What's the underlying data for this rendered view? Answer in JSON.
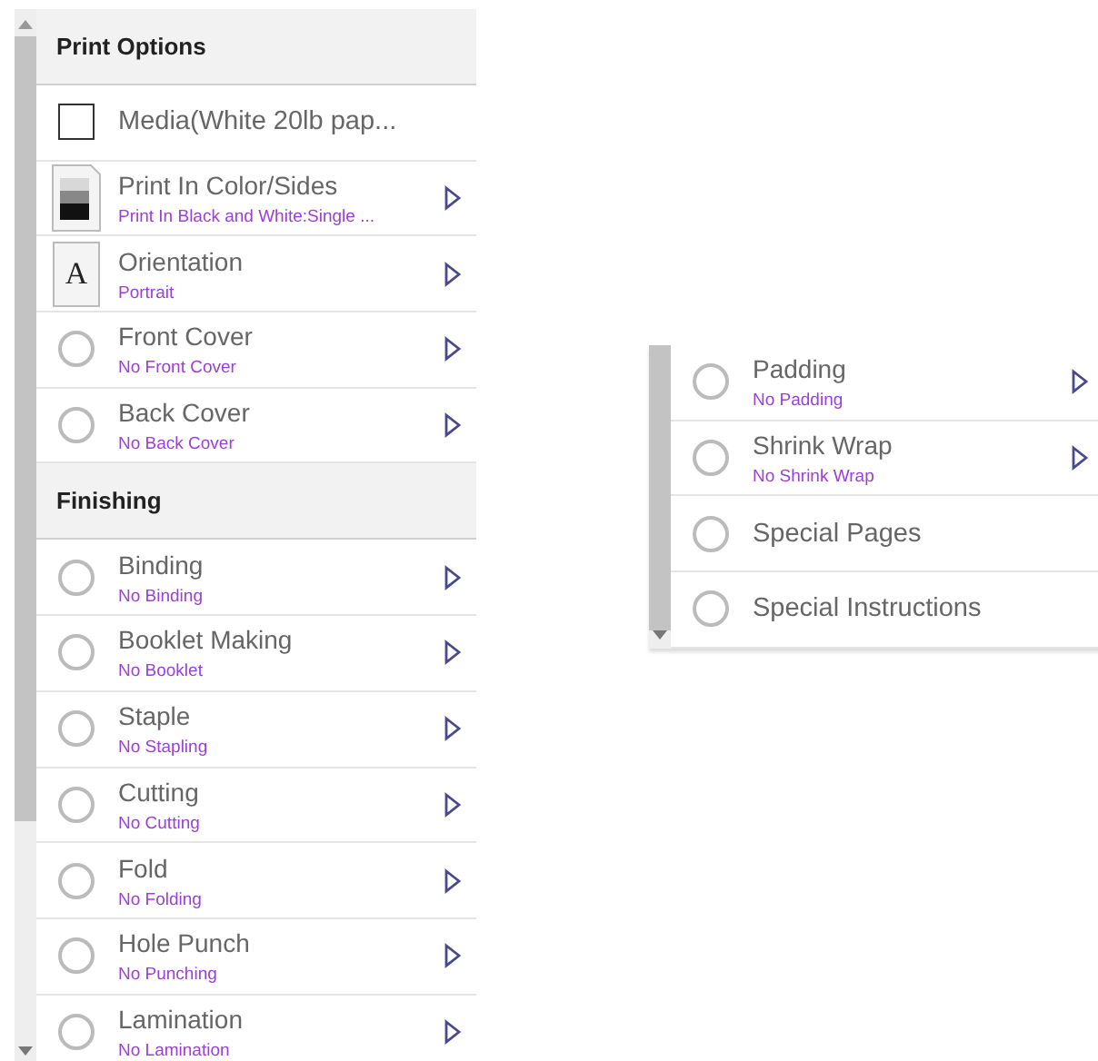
{
  "panels": [
    {
      "sections": [
        {
          "heading": "Print Options",
          "items": [
            {
              "kind": "checkbox",
              "title": "Media(White 20lb pap...",
              "checked": false,
              "has_submenu": false
            },
            {
              "kind": "color-swatch",
              "title": "Print In Color/Sides",
              "subtitle": "Print In Black and White:Single ...",
              "has_submenu": true
            },
            {
              "kind": "letter",
              "icon_letter": "A",
              "title": "Orientation",
              "subtitle": "Portrait",
              "has_submenu": true
            },
            {
              "kind": "radio",
              "title": "Front Cover",
              "subtitle": "No Front Cover",
              "selected": false,
              "has_submenu": true
            },
            {
              "kind": "radio",
              "title": "Back Cover",
              "subtitle": "No Back Cover",
              "selected": false,
              "has_submenu": true
            }
          ]
        },
        {
          "heading": "Finishing",
          "items": [
            {
              "kind": "radio",
              "title": "Binding",
              "subtitle": "No Binding",
              "selected": false,
              "has_submenu": true
            },
            {
              "kind": "radio",
              "title": "Booklet Making",
              "subtitle": "No Booklet",
              "selected": false,
              "has_submenu": true
            },
            {
              "kind": "radio",
              "title": "Staple",
              "subtitle": "No Stapling",
              "selected": false,
              "has_submenu": true
            },
            {
              "kind": "radio",
              "title": "Cutting",
              "subtitle": "No Cutting",
              "selected": false,
              "has_submenu": true
            },
            {
              "kind": "radio",
              "title": "Fold",
              "subtitle": "No Folding",
              "selected": false,
              "has_submenu": true
            },
            {
              "kind": "radio",
              "title": "Hole Punch",
              "subtitle": "No Punching",
              "selected": false,
              "has_submenu": true
            },
            {
              "kind": "radio",
              "title": "Lamination",
              "subtitle": "No Lamination",
              "selected": false,
              "has_submenu": true
            }
          ]
        }
      ]
    },
    {
      "sections": [
        {
          "items": [
            {
              "kind": "radio",
              "title": "Padding",
              "subtitle": "No Padding",
              "selected": false,
              "has_submenu": true
            },
            {
              "kind": "radio",
              "title": "Shrink Wrap",
              "subtitle": "No Shrink Wrap",
              "selected": false,
              "has_submenu": true
            },
            {
              "kind": "radio",
              "title": "Special Pages",
              "selected": false,
              "has_submenu": false
            },
            {
              "kind": "radio",
              "title": "Special Instructions",
              "selected": false,
              "has_submenu": false
            }
          ]
        }
      ]
    }
  ]
}
